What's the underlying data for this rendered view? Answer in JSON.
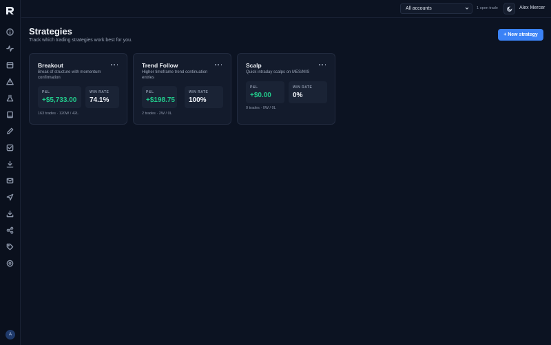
{
  "topbar": {
    "account_select": "All accounts",
    "open_trades": "1 open trade",
    "user_name": "Alex Mercer"
  },
  "sidebar": {
    "avatar_initial": "A",
    "icons": [
      "info-icon",
      "activity-icon",
      "calendar-icon",
      "alert-icon",
      "flask-icon",
      "book-icon",
      "pen-icon",
      "checklist-icon",
      "download-icon",
      "mail-icon",
      "send-icon",
      "import-icon",
      "share-icon",
      "tag-icon",
      "target-icon"
    ]
  },
  "header": {
    "title": "Strategies",
    "subtitle": "Track which trading strategies work best for you.",
    "new_button": "+ New strategy"
  },
  "strategies": [
    {
      "name": "Breakout",
      "description": "Break of structure with momentum confirmation",
      "pnl_label": "P&L",
      "pnl": "+$5,733.00",
      "wr_label": "WIN RATE",
      "win_rate": "74.1%",
      "footer": "163 trades · 120W / 42L"
    },
    {
      "name": "Trend Follow",
      "description": "Higher timeframe trend continuation entries",
      "pnl_label": "P&L",
      "pnl": "+$198.75",
      "wr_label": "WIN RATE",
      "win_rate": "100%",
      "footer": "2 trades · 2W / 0L"
    },
    {
      "name": "Scalp",
      "description": "Quick intraday scalps on MES/MIS",
      "pnl_label": "P&L",
      "pnl": "+$0.00",
      "wr_label": "WIN RATE",
      "win_rate": "0%",
      "footer": "0 trades · 0W / 0L"
    }
  ],
  "colors": {
    "background": "#0c1322",
    "card": "#131b2c",
    "accent": "#3b82f6",
    "profit": "#22c98b"
  }
}
